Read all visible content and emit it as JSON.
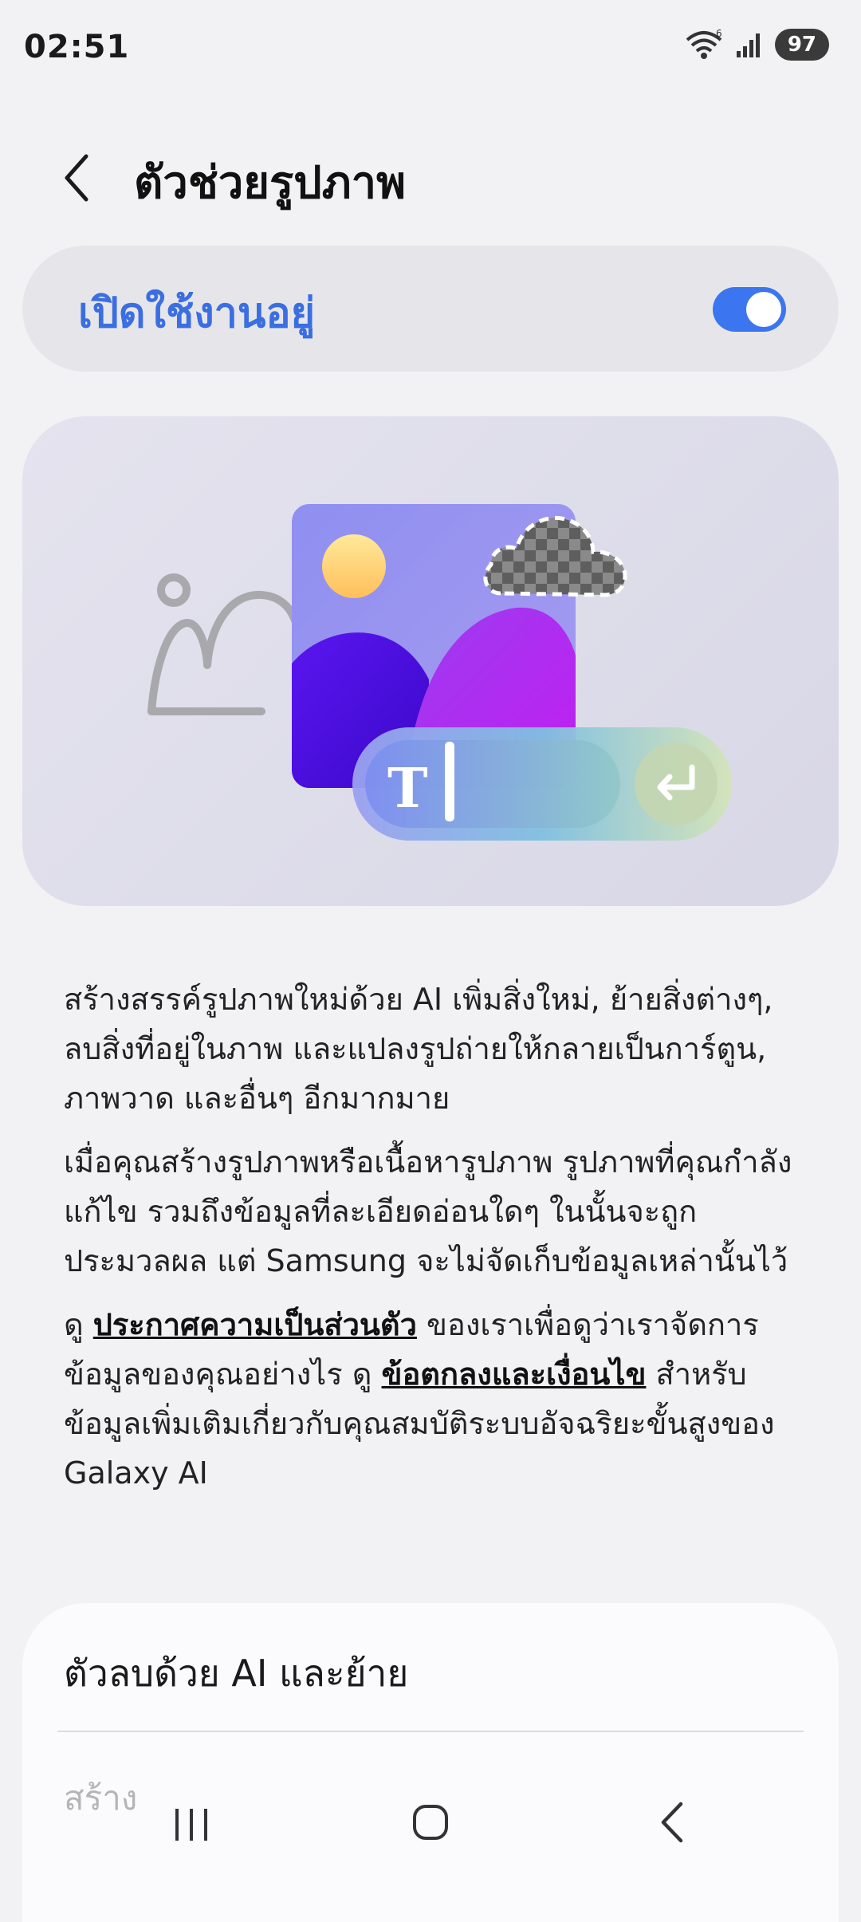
{
  "status_bar": {
    "time": "02:51",
    "battery": "97",
    "icons": [
      "wifi-icon",
      "signal-icon",
      "battery-icon"
    ]
  },
  "header": {
    "title": "ตัวช่วยรูปภาพ",
    "back_icon": "chevron-left-icon"
  },
  "toggle": {
    "label": "เปิดใช้งานอยู่",
    "state": "on",
    "accent_color": "#3b76f0"
  },
  "description": {
    "paragraph1": "สร้างสรรค์รูปภาพใหม่ด้วย AI เพิ่มสิ่งใหม่, ย้ายสิ่งต่างๆ, ลบสิ่งที่อยู่ในภาพ และแปลงรูปถ่ายให้กลายเป็นการ์ตูน, ภาพวาด และอื่นๆ อีกมากมาย",
    "paragraph2": "เมื่อคุณสร้างรูปภาพหรือเนื้อหารูปภาพ รูปภาพที่คุณกำลังแก้ไข รวมถึงข้อมูลที่ละเอียดอ่อนใดๆ ในนั้นจะถูกประมวลผล แต่ Samsung จะไม่จัดเก็บข้อมูลเหล่านั้นไว้",
    "p3_prefix": "ดู ",
    "p3_link1": "ประกาศความเป็นส่วนตัว",
    "p3_middle": " ของเราเพื่อดูว่าเราจัดการข้อมูลของคุณอย่างไร ดู ",
    "p3_link2": "ข้อตกลงและเงื่อนไข",
    "p3_suffix": " สำหรับข้อมูลเพิ่มเติมเกี่ยวกับคุณสมบัติระบบอัจฉริยะขั้นสูงของ Galaxy AI"
  },
  "list": {
    "item1": "ตัวลบด้วย AI และย้าย",
    "item2": "สร้าง"
  },
  "nav_bar": {
    "icons": [
      "recent-apps-icon",
      "home-icon",
      "back-icon"
    ]
  }
}
